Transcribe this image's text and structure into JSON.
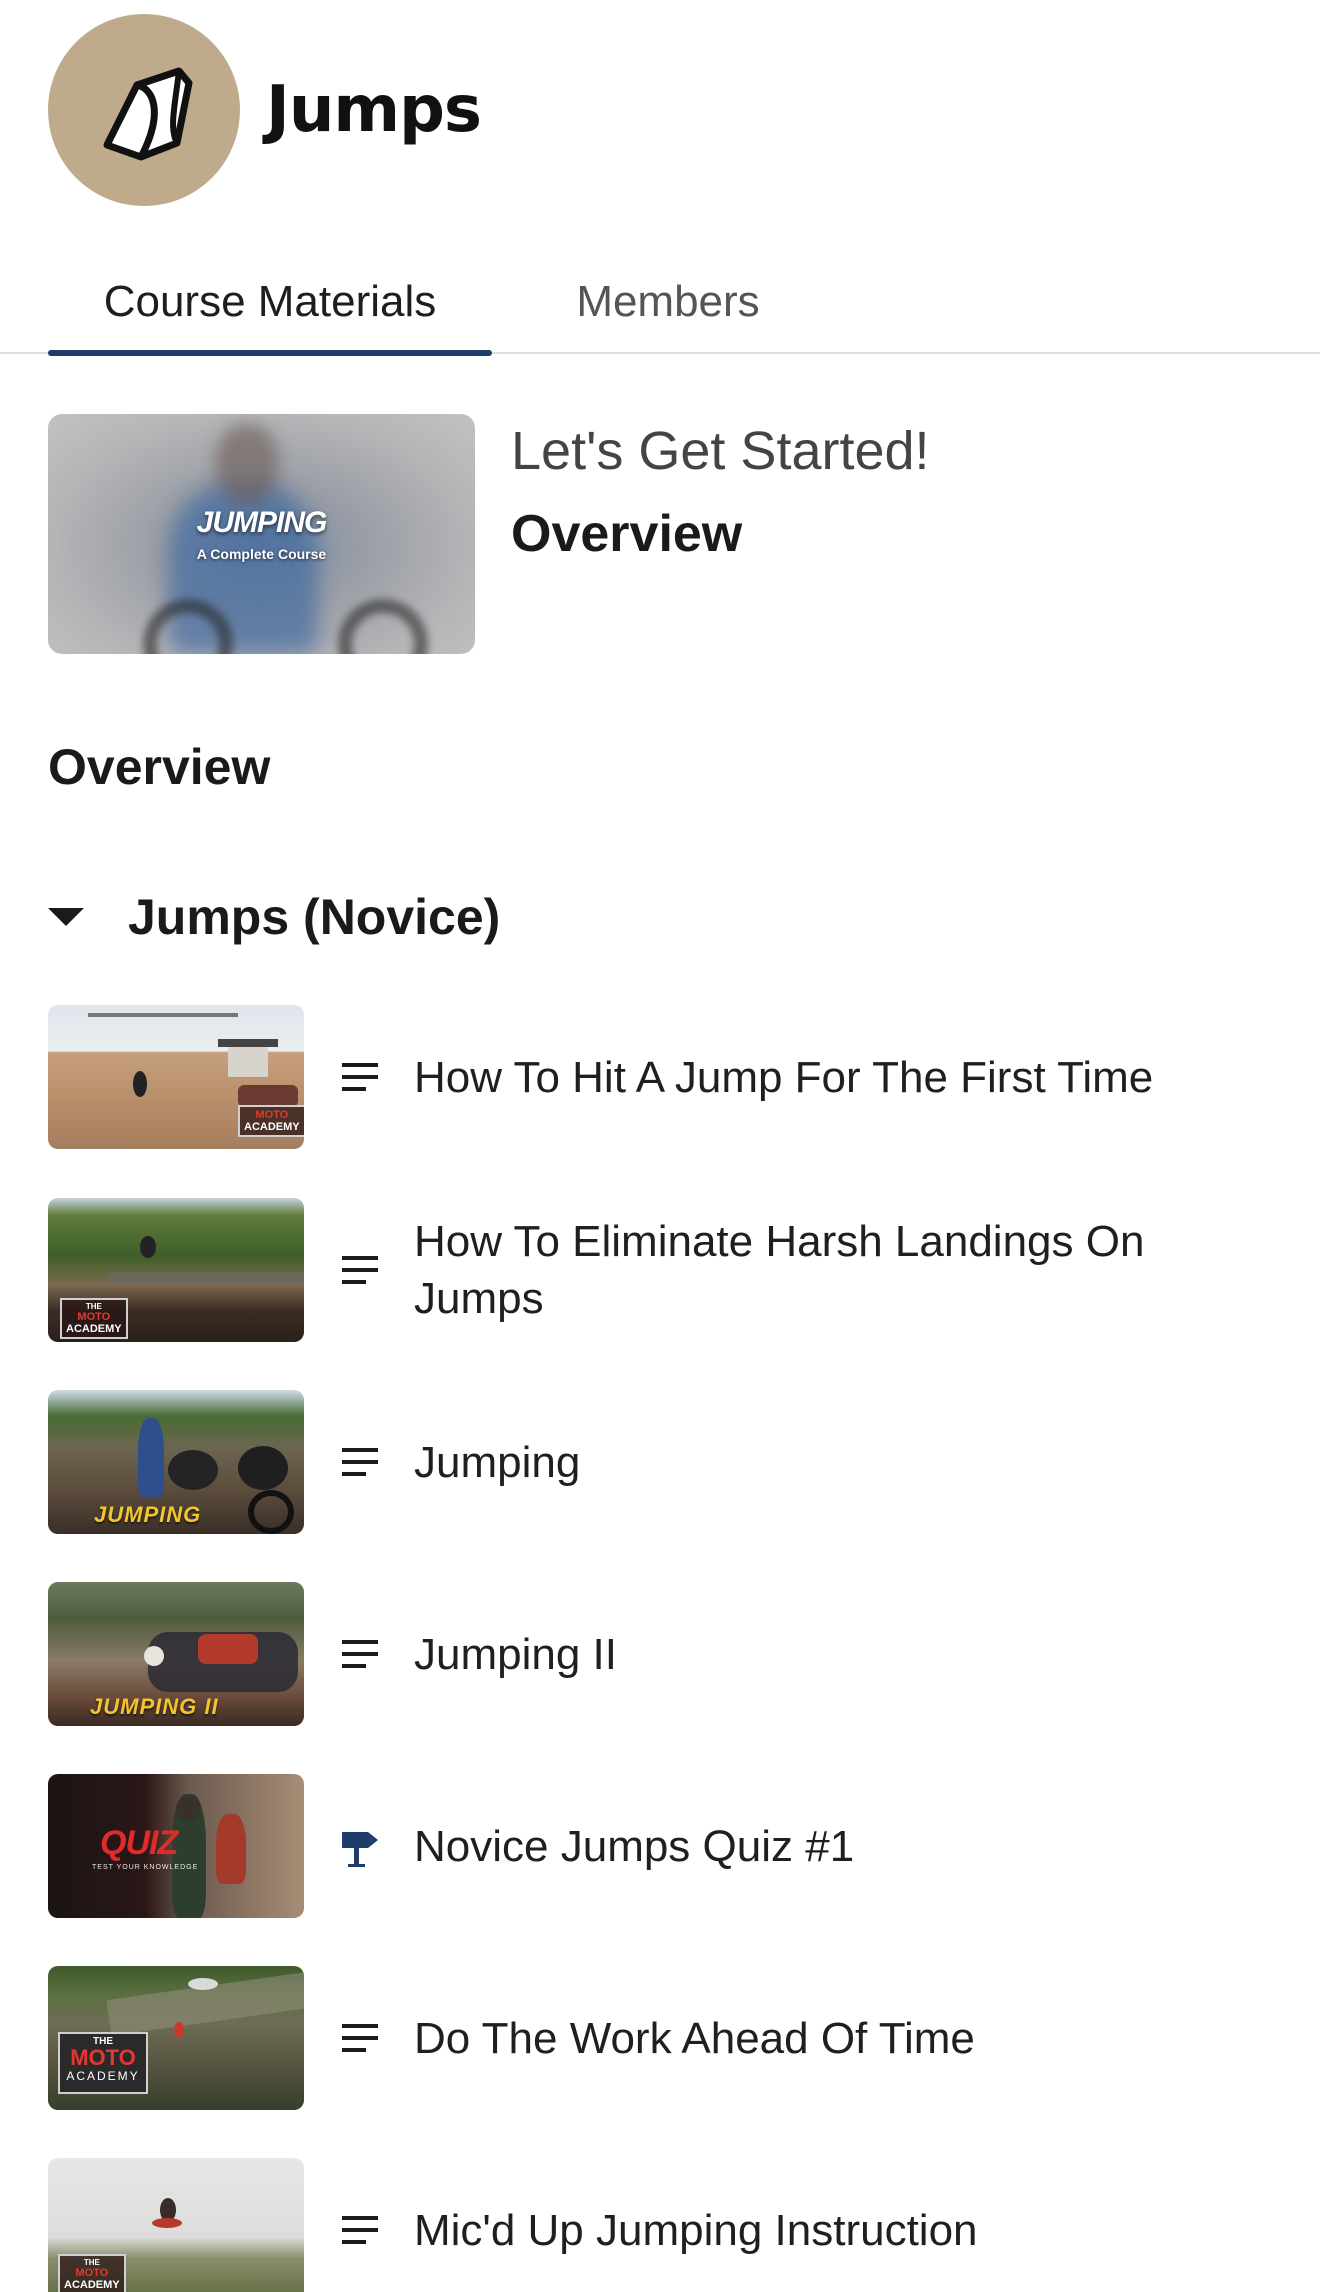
{
  "course": {
    "title": "Jumps",
    "avatar_icon": "ramp-icon",
    "avatar_color": "#bfab8b"
  },
  "tabs": [
    {
      "label": "Course Materials",
      "active": true
    },
    {
      "label": "Members",
      "active": false
    }
  ],
  "featured": {
    "kicker": "Let's Get Started!",
    "title": "Overview",
    "thumb_title": "JUMPING",
    "thumb_subtitle": "A Complete Course"
  },
  "section": {
    "title": "Overview"
  },
  "group": {
    "title": "Jumps (Novice)",
    "expanded": true
  },
  "lessons": [
    {
      "title": "How To Hit A Jump For The First Time",
      "icon": "lines-icon",
      "thumb_badge": [
        "MOTO",
        "ACADEMY"
      ]
    },
    {
      "title": "How To Eliminate Harsh Landings On Jumps",
      "icon": "lines-icon",
      "thumb_badge": [
        "THE",
        "MOTO",
        "ACADEMY"
      ]
    },
    {
      "title": "Jumping",
      "icon": "lines-icon",
      "thumb_label": "JUMPING"
    },
    {
      "title": "Jumping II",
      "icon": "lines-icon",
      "thumb_label": "JUMPING II"
    },
    {
      "title": "Novice Jumps Quiz #1",
      "icon": "signpost-icon",
      "thumb_label": "QUIZ",
      "thumb_sublabel": "TEST YOUR KNOWLEDGE"
    },
    {
      "title": "Do The Work Ahead Of Time",
      "icon": "lines-icon",
      "thumb_badge": [
        "THE",
        "MOTO",
        "ACADEMY"
      ]
    },
    {
      "title": "Mic'd Up Jumping Instruction",
      "icon": "lines-icon",
      "thumb_badge": [
        "THE",
        "MOTO",
        "ACADEMY"
      ]
    }
  ],
  "colors": {
    "accent": "#1f3d6b",
    "icon": "#1a1a1a"
  }
}
